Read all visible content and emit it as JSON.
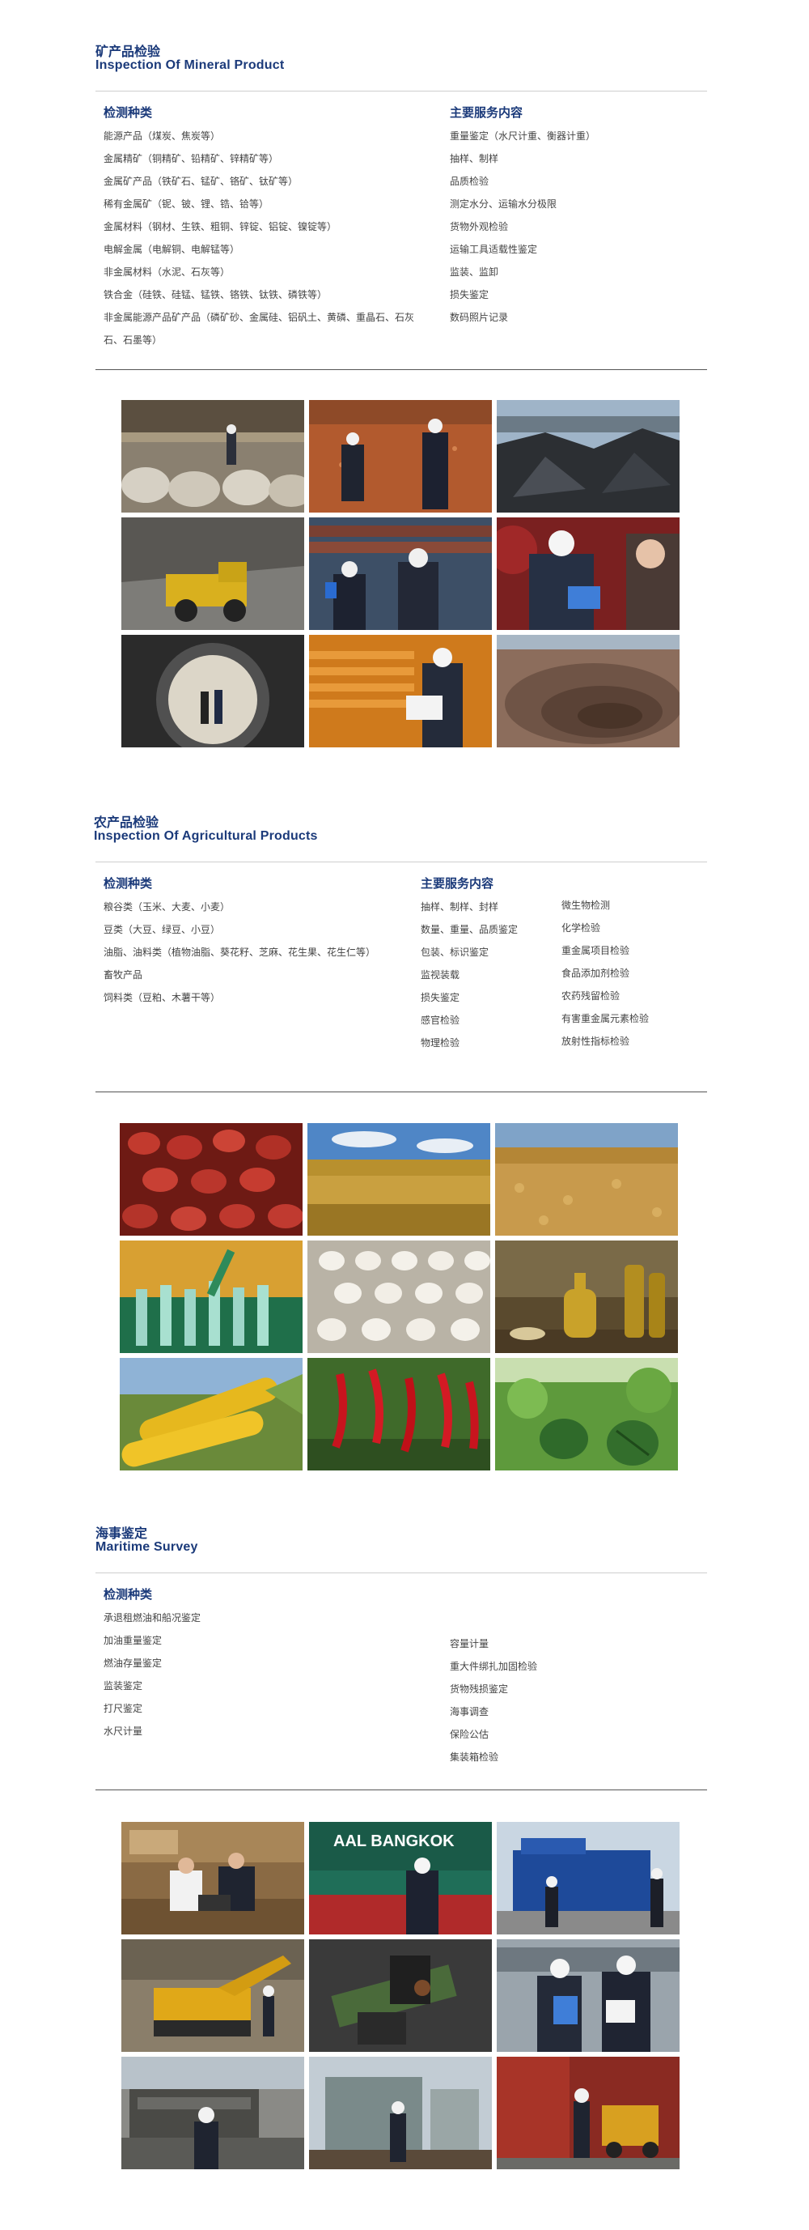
{
  "mineral": {
    "title_cn": "矿产品检验",
    "title_en": "Inspection Of Mineral Product",
    "col1_head": "检测种类",
    "col2_head": "主要服务内容",
    "col1_items": [
      "能源产品（煤炭、焦炭等）",
      "金属精矿（铜精矿、铅精矿、锌精矿等）",
      "金属矿产品（铁矿石、锰矿、铬矿、钛矿等）",
      "稀有金属矿（铌、铍、锂、锆、铪等）",
      "金属材料（钢材、生铁、粗铜、锌锭、铝锭、镍锭等）",
      "电解金属（电解铜、电解锰等）",
      "非金属材料（水泥、石灰等）",
      "铁合金（硅铁、硅锰、锰铁、铬铁、钛铁、磷铁等）",
      "非金属能源产品矿产品（磷矿砂、金属硅、铝矾土、黄磷、重晶石、石灰石、石墨等）"
    ],
    "col2_items": [
      "重量鉴定（水尺计重、衡器计重）",
      "抽样、制样",
      "品质检验",
      "测定水分、运输水分极限",
      "货物外观检验",
      "运输工具适载性鉴定",
      "监装、监卸",
      "损失鉴定",
      "数码照片记录"
    ]
  },
  "agri": {
    "title_cn": "农产品检验",
    "title_en": "Inspection Of Agricultural Products",
    "col1_head": "检测种类",
    "col2_head": "主要服务内容",
    "col1_items": [
      "粮谷类（玉米、大麦、小麦）",
      "豆类（大豆、绿豆、小豆）",
      "油脂、油料类（植物油脂、葵花籽、芝麻、花生果、花生仁等）",
      "畜牧产品",
      "饲料类（豆粕、木薯干等）"
    ],
    "col2_items": [
      "抽样、制样、封样",
      "数量、重量、品质鉴定",
      "包装、标识鉴定",
      "监视装载",
      "损失鉴定",
      "感官检验",
      "物理检验"
    ],
    "col3_items": [
      "微生物检测",
      "化学检验",
      "重金属项目检验",
      "食品添加剂检验",
      "农药残留检验",
      "有害重金属元素检验",
      "放射性指标检验"
    ]
  },
  "maritime": {
    "title_cn": "海事鉴定",
    "title_en": "Maritime Survey",
    "col1_head": "检测种类",
    "col1_items": [
      "承退租燃油和船况鉴定",
      "加油重量鉴定",
      "燃油存量鉴定",
      "监装鉴定",
      "打尺鉴定",
      "水尺计量"
    ],
    "col2_items": [
      "容量计量",
      "重大件绑扎加固检验",
      "货物残损鉴定",
      "海事调查",
      "保险公估",
      "集装箱检验"
    ],
    "ship_name": "AAL BANGKOK"
  }
}
